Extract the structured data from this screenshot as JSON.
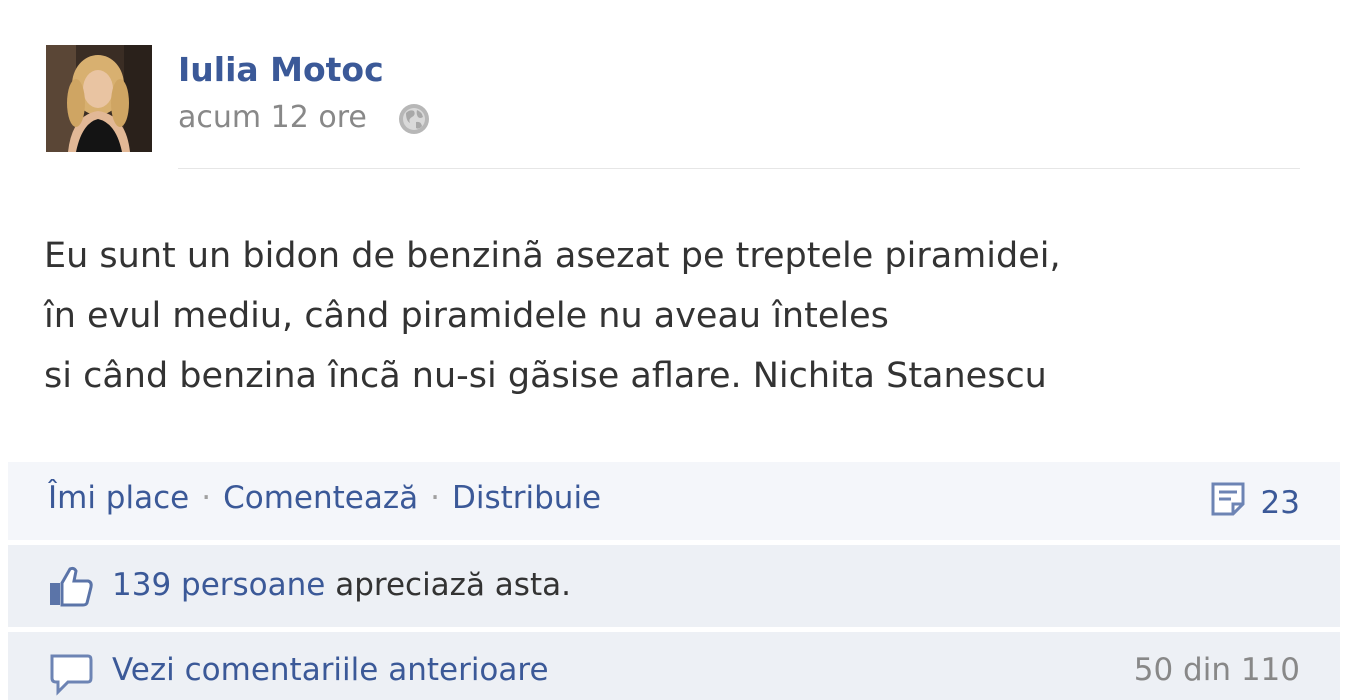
{
  "post": {
    "author": "Iulia Motoc",
    "time": "acum 12 ore",
    "privacy_icon": "globe-icon",
    "text_lines": [
      "Eu sunt un bidon de benzinã asezat pe treptele piramidei,",
      "în evul mediu, când piramidele nu aveau înteles",
      "si când benzina încã nu-si gãsise aflare. Nichita Stanescu"
    ]
  },
  "actions": {
    "like": "Îmi place",
    "comment": "Comentează",
    "share": "Distribuie",
    "separator": "·",
    "comment_count": "23"
  },
  "likes": {
    "people": "139 persoane",
    "suffix": " apreciază asta."
  },
  "comments": {
    "view_previous": "Vezi comentariile anterioare",
    "paging": "50 din 110"
  },
  "colors": {
    "link": "#3b5998",
    "text": "#333333",
    "muted": "#888888",
    "ufi_background": "#edf0f5"
  }
}
